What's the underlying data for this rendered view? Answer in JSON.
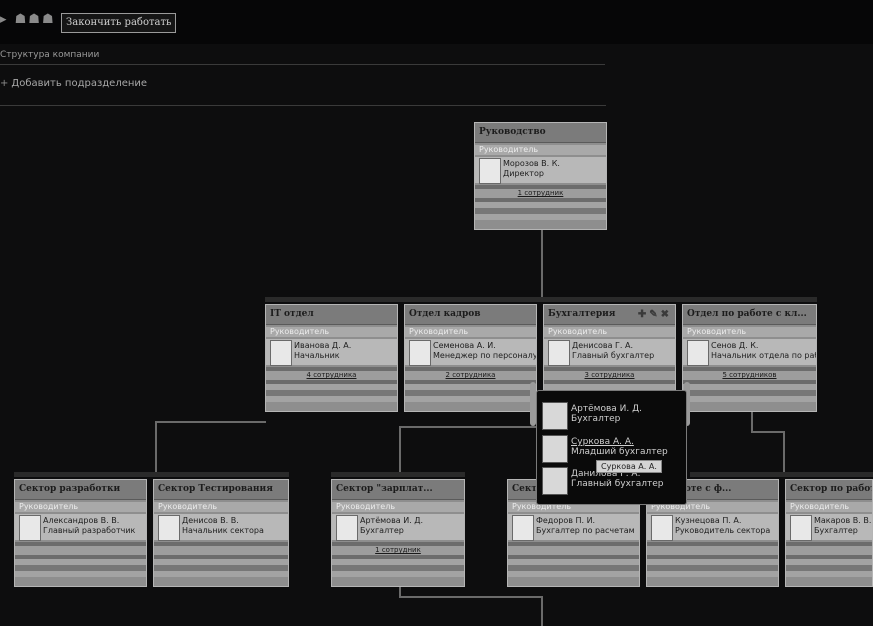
{
  "toolbar": {
    "finish_button": "Закончить работать"
  },
  "page": {
    "title": "Структура компании",
    "add_department": "Добавить подразделение"
  },
  "cards": [
    {
      "id": "root",
      "title": "Руководство",
      "role": "Руководитель",
      "person": "Морозов В. К.",
      "position": "Директор",
      "employees": "1 сотрудник"
    },
    {
      "id": "it",
      "title": "IT отдел",
      "role": "Руководитель",
      "person": "Иванова Д. А.",
      "position": "Начальник",
      "employees": "4 сотрудника"
    },
    {
      "id": "hr",
      "title": "Отдел кадров",
      "role": "Руководитель",
      "person": "Семенова А. И.",
      "position": "Менеджер по персоналу",
      "employees": "2 сотрудника"
    },
    {
      "id": "acc",
      "title": "Бухгалтерия",
      "role": "Руководитель",
      "person": "Денисова Г. А.",
      "position": "Главный бухгалтер",
      "employees": "3 сотрудника"
    },
    {
      "id": "cl",
      "title": "Отдел по работе с кл...",
      "role": "Руководитель",
      "person": "Сенов Д. К.",
      "position": "Начальник отдела по работе",
      "employees": "5 сотрудников"
    },
    {
      "id": "dev",
      "title": "Сектор разработки",
      "role": "Руководитель",
      "person": "Александров В. В.",
      "position": "Главный разработчик",
      "employees": ""
    },
    {
      "id": "test",
      "title": "Сектор Тестирования",
      "role": "Руководитель",
      "person": "Денисов В. В.",
      "position": "Начальник сектора",
      "employees": ""
    },
    {
      "id": "pay",
      "title": "Сектор \"зарплат...",
      "role": "Руководитель",
      "person": "Артёмова И. Д.",
      "position": "Бухгалтер",
      "employees": "1 сотрудник"
    },
    {
      "id": "s4",
      "title": "Сект",
      "role": "Руководитель",
      "person": "Федоров П. И.",
      "position": "Бухгалтер по расчетам",
      "employees": ""
    },
    {
      "id": "s5",
      "title": "по работе с ф...",
      "role": "Руководитель",
      "person": "Кузнецова П. А.",
      "position": "Руководитель сектора",
      "employees": ""
    },
    {
      "id": "s6",
      "title": "Сектор по работе",
      "role": "Руководитель",
      "person": "Макаров В. В.",
      "position": "Бухгалтер",
      "employees": ""
    }
  ],
  "popup": {
    "items": [
      {
        "name": "Артёмова И. Д.",
        "position": "Бухгалтер"
      },
      {
        "name": "Суркова А. А.",
        "position": "Младший бухгалтер"
      },
      {
        "name": "Данилова Г. А.",
        "position": "Главный бухгалтер"
      }
    ],
    "tooltip": "Суркова А. А."
  }
}
